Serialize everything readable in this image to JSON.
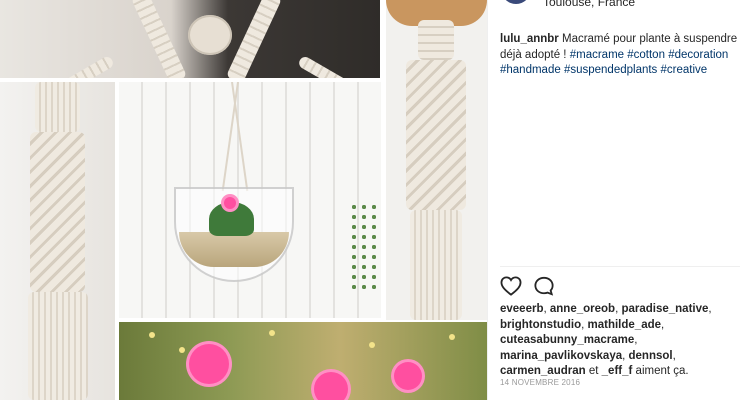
{
  "post": {
    "location": "Toulouse, France",
    "username": "lulu_annbr",
    "caption_text": "Macramé pour plante à suspendre déjà adopté !",
    "hashtags": [
      "#macrame",
      "#cotton",
      "#decoration",
      "#handmade",
      "#suspendedplants",
      "#creative"
    ],
    "likers": [
      "eveeerb",
      "anne_oreob",
      "paradise_native",
      "brightonstudio",
      "mathilde_ade",
      "cuteasabunny_macrame",
      "marina_pavlikovskaya",
      "dennsol",
      "carmen_audran",
      "_eff_f"
    ],
    "likes_suffix": "aiment ça.",
    "likes_conjunction": "et",
    "date": "14 NOVEMBRE 2016"
  },
  "icons": {
    "like": "heart-icon",
    "comment": "comment-icon"
  }
}
